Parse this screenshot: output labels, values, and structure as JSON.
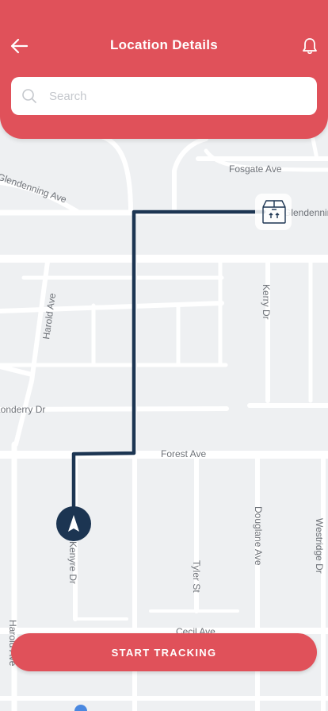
{
  "header": {
    "title": "Location Details",
    "back_icon": "arrow-left-icon",
    "notification_icon": "bell-icon"
  },
  "search": {
    "placeholder": "Search",
    "value": "",
    "icon": "search-icon"
  },
  "map": {
    "streets": {
      "fosgate": "Fosgate Ave",
      "glendenning_left": "Glendenning Ave",
      "glendenning_right": "Glendenning",
      "harold": "Harold Ave",
      "kerry": "Kerry Dr",
      "londonderry": "Londerry Dr",
      "forest": "Forest Ave",
      "kenyre": "Kenyre Dr",
      "tyler": "Tyler St",
      "douglane": "Douglane Ave",
      "westridge": "Westridge Dr",
      "cecil": "Cecil Ave",
      "harold_bottom": "Harold Ave"
    },
    "destination_icon": "package-box-icon",
    "origin_icon": "navigation-arrow-icon",
    "route_color": "#1c3552"
  },
  "footer": {
    "start_button": "START TRACKING"
  },
  "colors": {
    "accent": "#e0515a",
    "route": "#1c3552",
    "map_bg": "#eef0f2",
    "road": "#ffffff"
  }
}
